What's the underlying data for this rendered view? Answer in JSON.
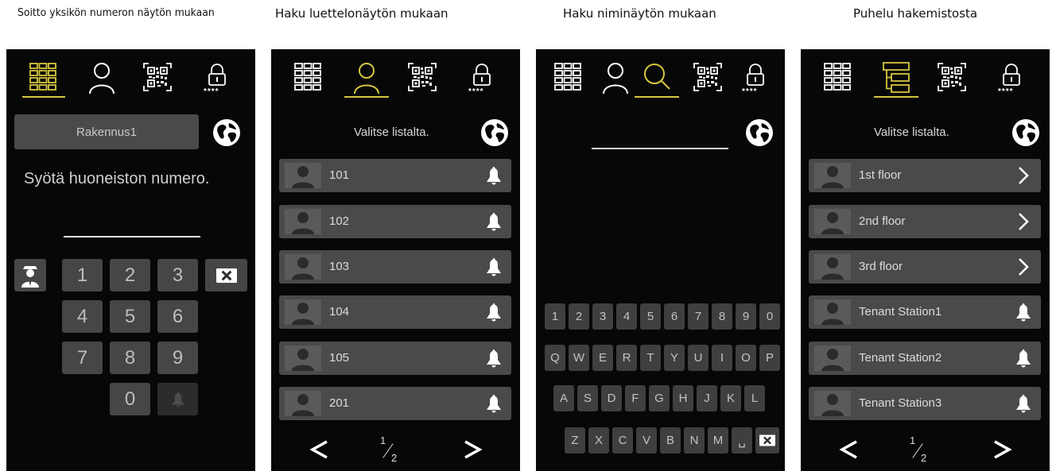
{
  "captions": {
    "p1": "Soitto yksikön numeron näytön mukaan",
    "p2": "Haku luettelonäytön mukaan",
    "p3": "Haku niminäytön mukaan",
    "p4": "Puhelu hakemistosta"
  },
  "colors": {
    "accent": "#d6c640",
    "panel_bg": "#070707",
    "button": "#4a4a4a",
    "icon_white": "#ffffff"
  },
  "panel1": {
    "active_tab": "keypad",
    "tabs": [
      "keypad-icon",
      "person-icon",
      "qr-code-icon",
      "lock-pin-icon"
    ],
    "lock_caption": "****",
    "building_field": "Rakennus1",
    "prompt": "Syötä huoneiston numero.",
    "keys": [
      "1",
      "2",
      "3",
      "4",
      "5",
      "6",
      "7",
      "8",
      "9",
      "0"
    ]
  },
  "panel2": {
    "active_tab": "person",
    "lock_caption": "****",
    "hint": "Valitse listalta.",
    "rows": [
      "101",
      "102",
      "103",
      "104",
      "105",
      "201"
    ],
    "page_num": "1",
    "page_den": "2"
  },
  "panel3": {
    "active_tab": "search",
    "lock_caption": "****",
    "kb_row1": [
      "1",
      "2",
      "3",
      "4",
      "5",
      "6",
      "7",
      "8",
      "9",
      "0"
    ],
    "kb_row2": [
      "Q",
      "W",
      "E",
      "R",
      "T",
      "Y",
      "U",
      "I",
      "O",
      "P"
    ],
    "kb_row3": [
      "A",
      "S",
      "D",
      "F",
      "G",
      "H",
      "J",
      "K",
      "L"
    ],
    "kb_row4": [
      "Z",
      "X",
      "C",
      "V",
      "B",
      "N",
      "M",
      "␣"
    ]
  },
  "panel4": {
    "active_tab": "directory",
    "lock_caption": "****",
    "hint": "Valitse listalta.",
    "rows": [
      "1st floor",
      "2nd floor",
      "3rd floor",
      "Tenant Station1",
      "Tenant Station2",
      "Tenant Station3"
    ],
    "row_actions": [
      "chevron-right-icon",
      "chevron-right-icon",
      "chevron-right-icon",
      "bell-icon",
      "bell-icon",
      "bell-icon"
    ],
    "page_num": "1",
    "page_den": "2"
  }
}
